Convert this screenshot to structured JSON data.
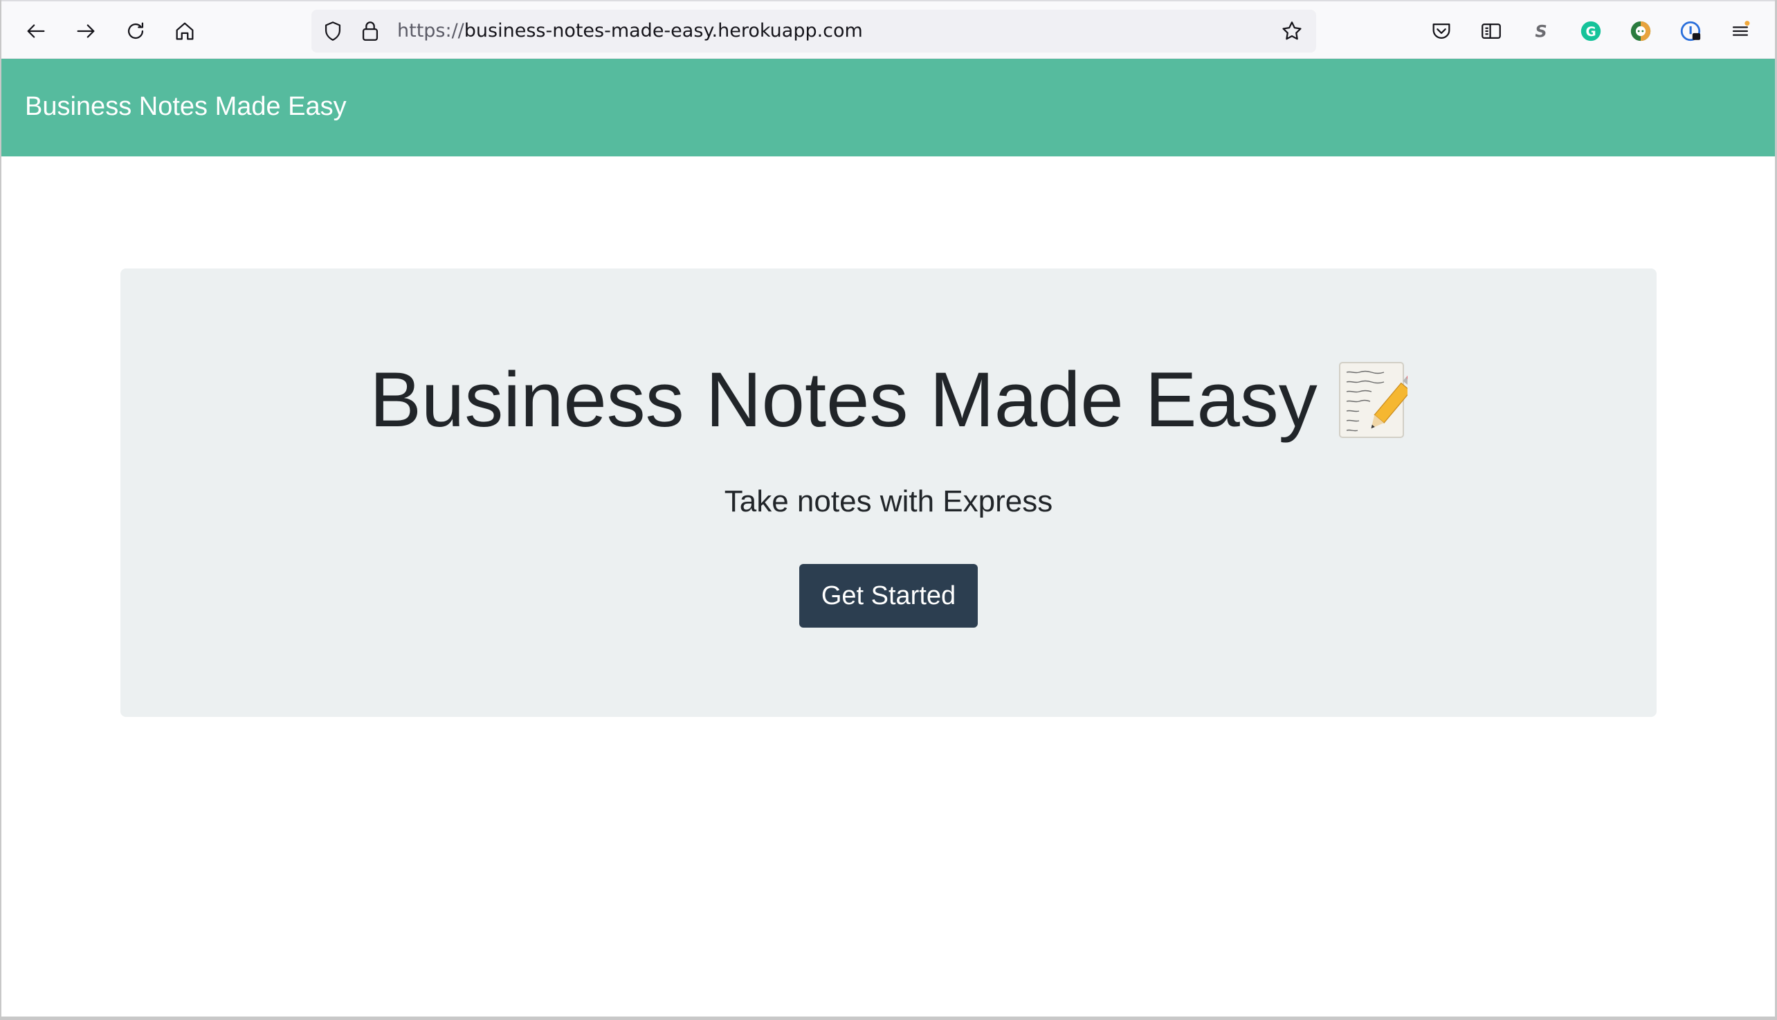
{
  "browser": {
    "url_scheme": "https://",
    "url_host": "business-notes-made-easy.herokuapp.com",
    "icons": [
      "back-arrow-icon",
      "forward-arrow-icon",
      "reload-icon",
      "home-icon",
      "shield-icon",
      "lock-icon",
      "star-icon",
      "pocket-icon",
      "reader-view-icon",
      "s-extension-icon",
      "grammarly-icon",
      "chat-extension-icon",
      "password-extension-icon",
      "menu-icon"
    ]
  },
  "navbar": {
    "brand": "Business Notes Made Easy",
    "color": "#56bb9e"
  },
  "hero": {
    "title": "Business Notes Made Easy",
    "emoji": "memo-icon",
    "lead": "Take notes with Express",
    "button_label": "Get Started",
    "button_color": "#2c3e50",
    "background": "#ecf0f1"
  }
}
